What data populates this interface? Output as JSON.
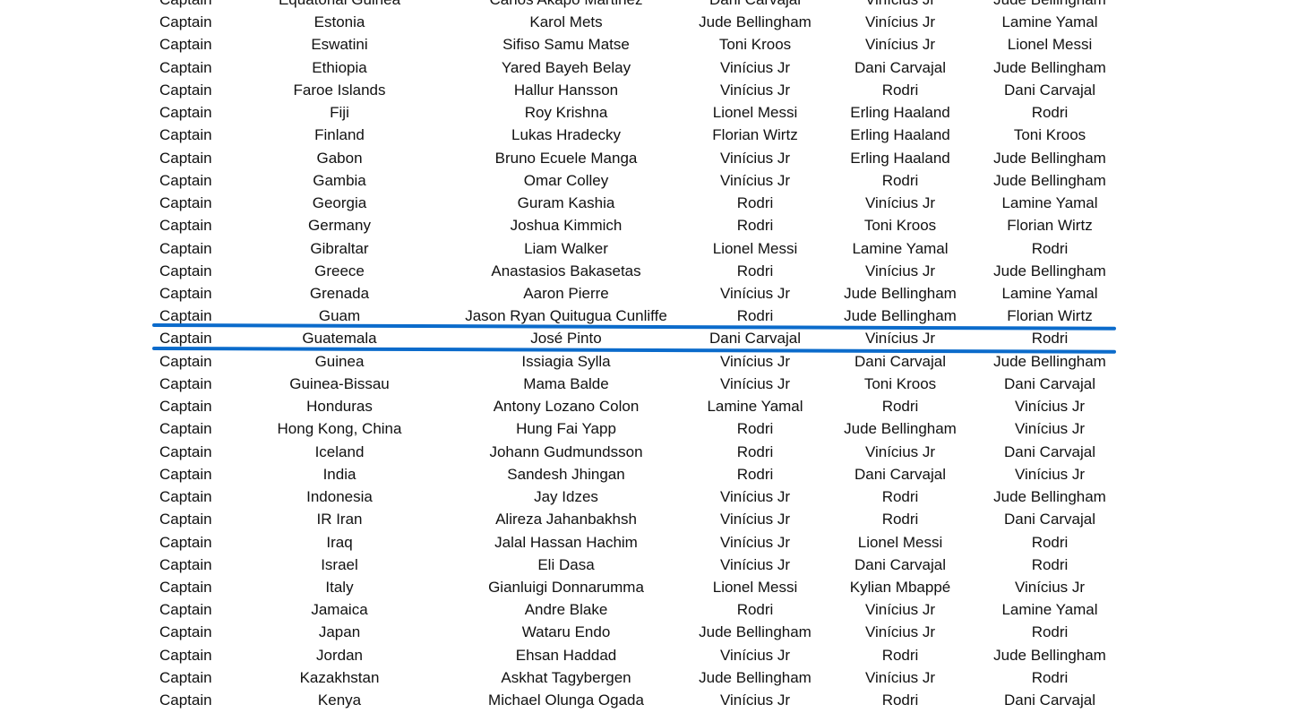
{
  "highlight_color": "#0b6bcb",
  "highlighted_row": "Guatemala",
  "rows": [
    [
      "Captain",
      "Equatorial Guinea",
      "Carlos Akapo Martinez",
      "Dani Carvajal",
      "Vinícius Jr",
      "Jude Bellingham"
    ],
    [
      "Captain",
      "Estonia",
      "Karol Mets",
      "Jude Bellingham",
      "Vinícius Jr",
      "Lamine Yamal"
    ],
    [
      "Captain",
      "Eswatini",
      "Sifiso Samu Matse",
      "Toni Kroos",
      "Vinícius Jr",
      "Lionel Messi"
    ],
    [
      "Captain",
      "Ethiopia",
      "Yared Bayeh Belay",
      "Vinícius Jr",
      "Dani Carvajal",
      "Jude Bellingham"
    ],
    [
      "Captain",
      "Faroe Islands",
      "Hallur Hansson",
      "Vinícius Jr",
      "Rodri",
      "Dani Carvajal"
    ],
    [
      "Captain",
      "Fiji",
      "Roy Krishna",
      "Lionel Messi",
      "Erling Haaland",
      "Rodri"
    ],
    [
      "Captain",
      "Finland",
      "Lukas Hradecky",
      "Florian Wirtz",
      "Erling Haaland",
      "Toni Kroos"
    ],
    [
      "Captain",
      "Gabon",
      "Bruno Ecuele Manga",
      "Vinícius Jr",
      "Erling Haaland",
      "Jude Bellingham"
    ],
    [
      "Captain",
      "Gambia",
      "Omar Colley",
      "Vinícius Jr",
      "Rodri",
      "Jude Bellingham"
    ],
    [
      "Captain",
      "Georgia",
      "Guram Kashia",
      "Rodri",
      "Vinícius Jr",
      "Lamine Yamal"
    ],
    [
      "Captain",
      "Germany",
      "Joshua Kimmich",
      "Rodri",
      "Toni Kroos",
      "Florian Wirtz"
    ],
    [
      "Captain",
      "Gibraltar",
      "Liam Walker",
      "Lionel Messi",
      "Lamine Yamal",
      "Rodri"
    ],
    [
      "Captain",
      "Greece",
      "Anastasios Bakasetas",
      "Rodri",
      "Vinícius Jr",
      "Jude Bellingham"
    ],
    [
      "Captain",
      "Grenada",
      "Aaron Pierre",
      "Vinícius Jr",
      "Jude Bellingham",
      "Lamine Yamal"
    ],
    [
      "Captain",
      "Guam",
      "Jason Ryan Quitugua Cunliffe",
      "Rodri",
      "Jude Bellingham",
      "Florian Wirtz"
    ],
    [
      "Captain",
      "Guatemala",
      "José Pinto",
      "Dani Carvajal",
      "Vinícius Jr",
      "Rodri"
    ],
    [
      "Captain",
      "Guinea",
      "Issiagia Sylla",
      "Vinícius Jr",
      "Dani Carvajal",
      "Jude Bellingham"
    ],
    [
      "Captain",
      "Guinea-Bissau",
      "Mama Balde",
      "Vinícius Jr",
      "Toni Kroos",
      "Dani Carvajal"
    ],
    [
      "Captain",
      "Honduras",
      "Antony Lozano Colon",
      "Lamine Yamal",
      "Rodri",
      "Vinícius Jr"
    ],
    [
      "Captain",
      "Hong Kong, China",
      "Hung Fai Yapp",
      "Rodri",
      "Jude Bellingham",
      "Vinícius Jr"
    ],
    [
      "Captain",
      "Iceland",
      "Johann Gudmundsson",
      "Rodri",
      "Vinícius Jr",
      "Dani Carvajal"
    ],
    [
      "Captain",
      "India",
      "Sandesh Jhingan",
      "Rodri",
      "Dani Carvajal",
      "Vinícius Jr"
    ],
    [
      "Captain",
      "Indonesia",
      "Jay Idzes",
      "Vinícius Jr",
      "Rodri",
      "Jude Bellingham"
    ],
    [
      "Captain",
      "IR Iran",
      "Alireza Jahanbakhsh",
      "Vinícius Jr",
      "Rodri",
      "Dani Carvajal"
    ],
    [
      "Captain",
      "Iraq",
      "Jalal Hassan Hachim",
      "Vinícius Jr",
      "Lionel Messi",
      "Rodri"
    ],
    [
      "Captain",
      "Israel",
      "Eli Dasa",
      "Vinícius Jr",
      "Dani Carvajal",
      "Rodri"
    ],
    [
      "Captain",
      "Italy",
      "Gianluigi Donnarumma",
      "Lionel Messi",
      "Kylian Mbappé",
      "Vinícius Jr"
    ],
    [
      "Captain",
      "Jamaica",
      "Andre Blake",
      "Rodri",
      "Vinícius Jr",
      "Lamine Yamal"
    ],
    [
      "Captain",
      "Japan",
      "Wataru Endo",
      "Jude Bellingham",
      "Vinícius Jr",
      "Rodri"
    ],
    [
      "Captain",
      "Jordan",
      "Ehsan Haddad",
      "Vinícius Jr",
      "Rodri",
      "Jude Bellingham"
    ],
    [
      "Captain",
      "Kazakhstan",
      "Askhat Tagybergen",
      "Jude Bellingham",
      "Vinícius Jr",
      "Rodri"
    ],
    [
      "Captain",
      "Kenya",
      "Michael Olunga Ogada",
      "Vinícius Jr",
      "Rodri",
      "Dani Carvajal"
    ]
  ]
}
